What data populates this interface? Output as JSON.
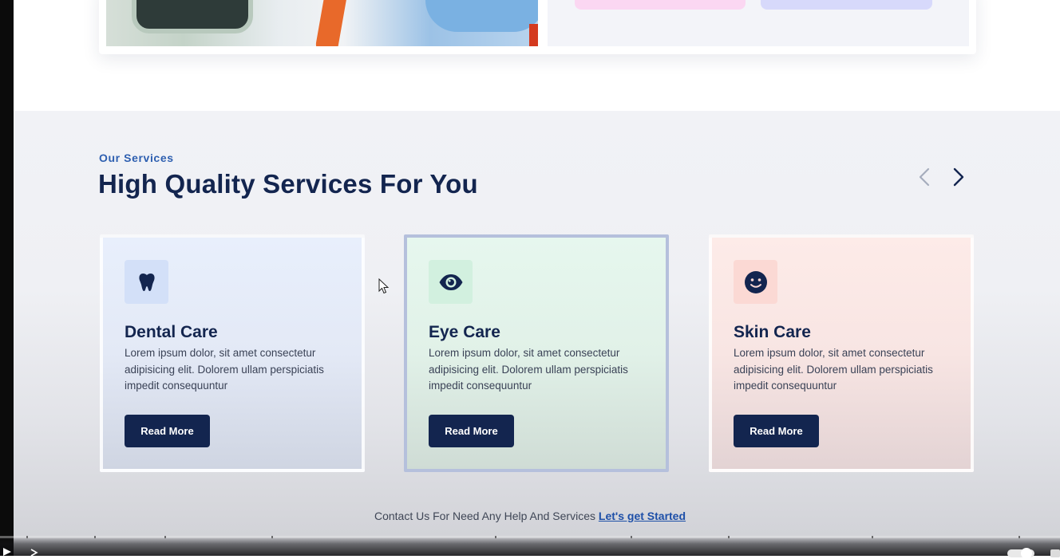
{
  "services": {
    "eyebrow": "Our Services",
    "title": "High Quality Services For You",
    "cards": [
      {
        "icon": "tooth-icon",
        "title": "Dental Care",
        "description": "Lorem ipsum dolor, sit amet consectetur adipisicing elit. Dolorem ullam perspiciatis impedit consequuntur",
        "button_label": "Read More",
        "accent_color": "#d3e0f8"
      },
      {
        "icon": "eye-icon",
        "title": "Eye Care",
        "description": "Lorem ipsum dolor, sit amet consectetur adipisicing elit. Dolorem ullam perspiciatis impedit consequuntur",
        "button_label": "Read More",
        "accent_color": "#d2f0df"
      },
      {
        "icon": "smiley-icon",
        "title": "Skin Care",
        "description": "Lorem ipsum dolor, sit amet consectetur adipisicing elit. Dolorem ullam perspiciatis impedit consequuntur",
        "button_label": "Read More",
        "accent_color": "#fbd9d4"
      }
    ],
    "nav": {
      "prev_icon": "chevron-left-icon",
      "next_icon": "chevron-right-icon"
    }
  },
  "contact": {
    "text": "Contact Us For Need Any Help And Services ",
    "link_label": "Let's get Started"
  },
  "colors": {
    "navy": "#13254f",
    "link_blue": "#1d4fa8",
    "eyebrow_blue": "#2d5fb0"
  }
}
